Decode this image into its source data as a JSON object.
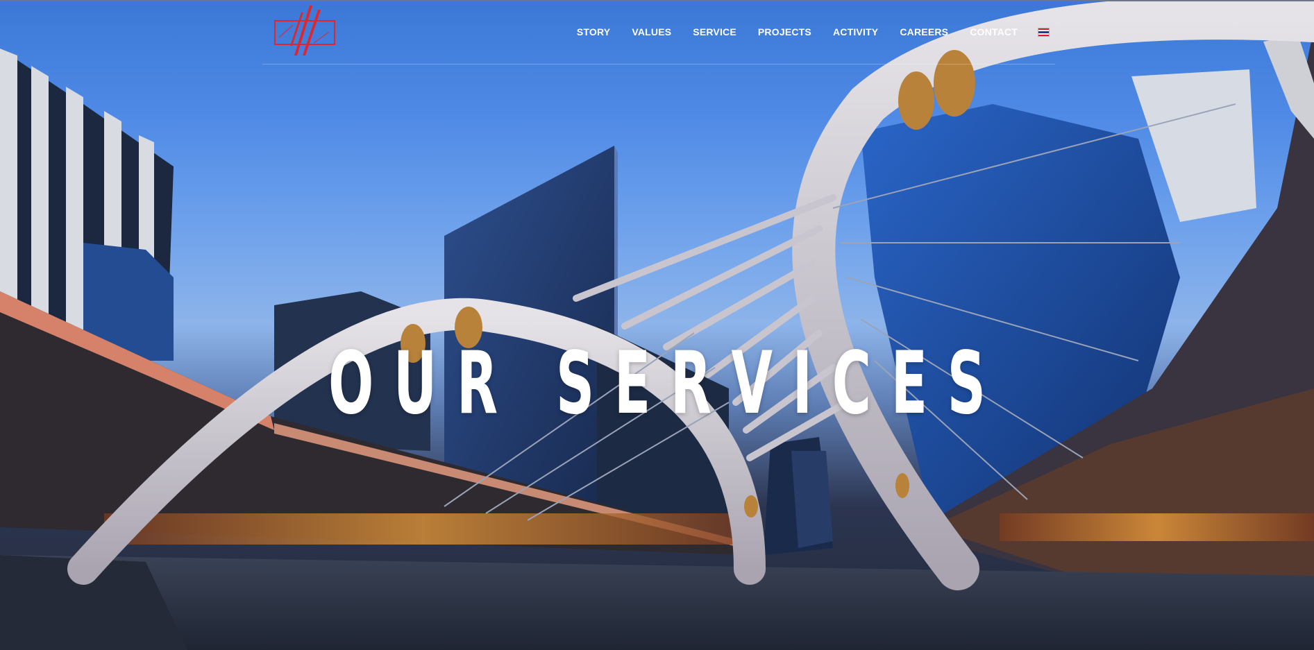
{
  "header": {
    "logo_icon": "company-logo",
    "nav": [
      {
        "label": "STORY"
      },
      {
        "label": "VALUES"
      },
      {
        "label": "SERVICE"
      },
      {
        "label": "PROJECTS"
      },
      {
        "label": "ACTIVITY"
      },
      {
        "label": "CAREERS"
      },
      {
        "label": "CONTACT"
      }
    ],
    "language_icon": "thai-flag-icon"
  },
  "hero": {
    "title": "OUR SERVICES",
    "background_icon": "skywalk-cityscape-photo"
  },
  "colors": {
    "nav_text": "#ffffff",
    "logo_red": "#e0262c",
    "sky_top": "#3b78d6",
    "ground": "#232a3a"
  }
}
